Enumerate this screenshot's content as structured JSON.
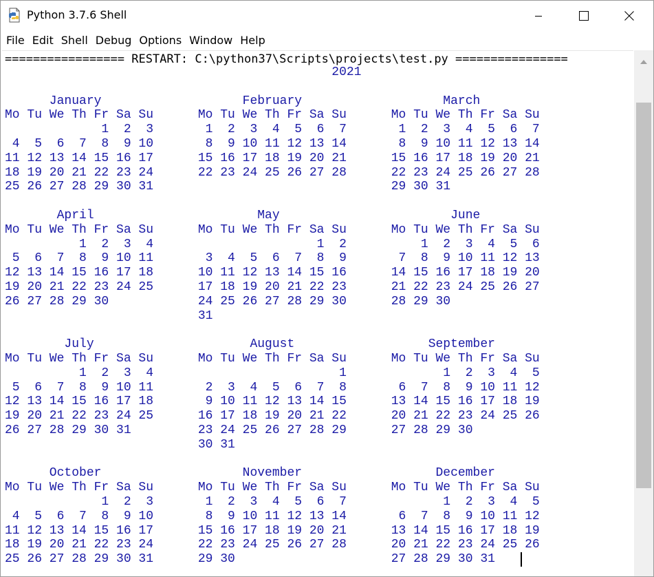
{
  "window": {
    "title": "Python 3.7.6 Shell"
  },
  "menu": {
    "items": [
      "File",
      "Edit",
      "Shell",
      "Debug",
      "Options",
      "Window",
      "Help"
    ]
  },
  "shell": {
    "banner": "================= RESTART: C:\\python37\\Scripts\\projects\\test.py ================",
    "calendar": "                                            2021\n\n      January                   February                   March\nMo Tu We Th Fr Sa Su      Mo Tu We Th Fr Sa Su      Mo Tu We Th Fr Sa Su\n             1  2  3       1  2  3  4  5  6  7       1  2  3  4  5  6  7\n 4  5  6  7  8  9 10       8  9 10 11 12 13 14       8  9 10 11 12 13 14\n11 12 13 14 15 16 17      15 16 17 18 19 20 21      15 16 17 18 19 20 21\n18 19 20 21 22 23 24      22 23 24 25 26 27 28      22 23 24 25 26 27 28\n25 26 27 28 29 30 31                                29 30 31\n\n       April                      May                       June\nMo Tu We Th Fr Sa Su      Mo Tu We Th Fr Sa Su      Mo Tu We Th Fr Sa Su\n          1  2  3  4                      1  2          1  2  3  4  5  6\n 5  6  7  8  9 10 11       3  4  5  6  7  8  9       7  8  9 10 11 12 13\n12 13 14 15 16 17 18      10 11 12 13 14 15 16      14 15 16 17 18 19 20\n19 20 21 22 23 24 25      17 18 19 20 21 22 23      21 22 23 24 25 26 27\n26 27 28 29 30            24 25 26 27 28 29 30      28 29 30\n                          31\n\n        July                     August                  September\nMo Tu We Th Fr Sa Su      Mo Tu We Th Fr Sa Su      Mo Tu We Th Fr Sa Su\n          1  2  3  4                         1             1  2  3  4  5\n 5  6  7  8  9 10 11       2  3  4  5  6  7  8       6  7  8  9 10 11 12\n12 13 14 15 16 17 18       9 10 11 12 13 14 15      13 14 15 16 17 18 19\n19 20 21 22 23 24 25      16 17 18 19 20 21 22      20 21 22 23 24 25 26\n26 27 28 29 30 31         23 24 25 26 27 28 29      27 28 29 30\n                          30 31\n\n      October                   November                  December\nMo Tu We Th Fr Sa Su      Mo Tu We Th Fr Sa Su      Mo Tu We Th Fr Sa Su\n             1  2  3       1  2  3  4  5  6  7             1  2  3  4  5\n 4  5  6  7  8  9 10       8  9 10 11 12 13 14       6  7  8  9 10 11 12\n11 12 13 14 15 16 17      15 16 17 18 19 20 21      13 14 15 16 17 18 19\n18 19 20 21 22 23 24      22 23 24 25 26 27 28      20 21 22 23 24 25 26\n25 26 27 28 29 30 31      29 30                     27 28 29 30 31"
  },
  "icons": {
    "app": "python-idle-icon",
    "minimize": "minimize-icon",
    "maximize": "maximize-icon",
    "close": "close-icon"
  },
  "colors": {
    "output_text": "#1a1aa6",
    "banner_text": "#000000"
  }
}
